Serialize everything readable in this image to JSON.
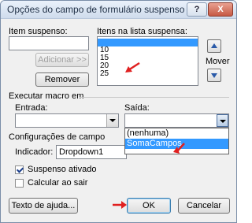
{
  "window": {
    "title": "Opções do campo de formulário suspenso",
    "help": "?",
    "close": "X"
  },
  "item_suspenso": {
    "label": "Item suspenso:",
    "value": ""
  },
  "itens_lista": {
    "label": "Itens na lista suspensa:",
    "items": [
      "",
      "10",
      "15",
      "20",
      "25"
    ]
  },
  "buttons": {
    "adicionar": "Adicionar >>",
    "remover": "Remover",
    "mover": "Mover",
    "ajuda": "Texto de ajuda...",
    "ok": "OK",
    "cancelar": "Cancelar"
  },
  "macro": {
    "section": "Executar macro em",
    "entrada_label": "Entrada:",
    "saida_label": "Saída:",
    "entrada_value": "",
    "saida_value": "",
    "options": [
      "(nenhuma)",
      "SomaCampos"
    ]
  },
  "config": {
    "section": "Configurações de campo",
    "indicador_label": "Indicador:",
    "indicador_value": "Dropdown1",
    "suspenso_label": "Suspenso ativado",
    "calcular_label": "Calcular ao sair"
  },
  "colors": {
    "selection": "#3399ff",
    "arrow": "#e02020"
  }
}
